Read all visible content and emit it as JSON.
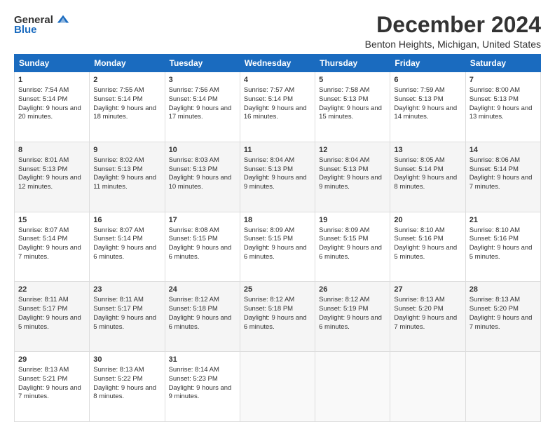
{
  "logo": {
    "general": "General",
    "blue": "Blue"
  },
  "title": "December 2024",
  "subtitle": "Benton Heights, Michigan, United States",
  "headers": [
    "Sunday",
    "Monday",
    "Tuesday",
    "Wednesday",
    "Thursday",
    "Friday",
    "Saturday"
  ],
  "weeks": [
    [
      {
        "day": "1",
        "sunrise": "Sunrise: 7:54 AM",
        "sunset": "Sunset: 5:14 PM",
        "daylight": "Daylight: 9 hours and 20 minutes."
      },
      {
        "day": "2",
        "sunrise": "Sunrise: 7:55 AM",
        "sunset": "Sunset: 5:14 PM",
        "daylight": "Daylight: 9 hours and 18 minutes."
      },
      {
        "day": "3",
        "sunrise": "Sunrise: 7:56 AM",
        "sunset": "Sunset: 5:14 PM",
        "daylight": "Daylight: 9 hours and 17 minutes."
      },
      {
        "day": "4",
        "sunrise": "Sunrise: 7:57 AM",
        "sunset": "Sunset: 5:14 PM",
        "daylight": "Daylight: 9 hours and 16 minutes."
      },
      {
        "day": "5",
        "sunrise": "Sunrise: 7:58 AM",
        "sunset": "Sunset: 5:13 PM",
        "daylight": "Daylight: 9 hours and 15 minutes."
      },
      {
        "day": "6",
        "sunrise": "Sunrise: 7:59 AM",
        "sunset": "Sunset: 5:13 PM",
        "daylight": "Daylight: 9 hours and 14 minutes."
      },
      {
        "day": "7",
        "sunrise": "Sunrise: 8:00 AM",
        "sunset": "Sunset: 5:13 PM",
        "daylight": "Daylight: 9 hours and 13 minutes."
      }
    ],
    [
      {
        "day": "8",
        "sunrise": "Sunrise: 8:01 AM",
        "sunset": "Sunset: 5:13 PM",
        "daylight": "Daylight: 9 hours and 12 minutes."
      },
      {
        "day": "9",
        "sunrise": "Sunrise: 8:02 AM",
        "sunset": "Sunset: 5:13 PM",
        "daylight": "Daylight: 9 hours and 11 minutes."
      },
      {
        "day": "10",
        "sunrise": "Sunrise: 8:03 AM",
        "sunset": "Sunset: 5:13 PM",
        "daylight": "Daylight: 9 hours and 10 minutes."
      },
      {
        "day": "11",
        "sunrise": "Sunrise: 8:04 AM",
        "sunset": "Sunset: 5:13 PM",
        "daylight": "Daylight: 9 hours and 9 minutes."
      },
      {
        "day": "12",
        "sunrise": "Sunrise: 8:04 AM",
        "sunset": "Sunset: 5:13 PM",
        "daylight": "Daylight: 9 hours and 9 minutes."
      },
      {
        "day": "13",
        "sunrise": "Sunrise: 8:05 AM",
        "sunset": "Sunset: 5:14 PM",
        "daylight": "Daylight: 9 hours and 8 minutes."
      },
      {
        "day": "14",
        "sunrise": "Sunrise: 8:06 AM",
        "sunset": "Sunset: 5:14 PM",
        "daylight": "Daylight: 9 hours and 7 minutes."
      }
    ],
    [
      {
        "day": "15",
        "sunrise": "Sunrise: 8:07 AM",
        "sunset": "Sunset: 5:14 PM",
        "daylight": "Daylight: 9 hours and 7 minutes."
      },
      {
        "day": "16",
        "sunrise": "Sunrise: 8:07 AM",
        "sunset": "Sunset: 5:14 PM",
        "daylight": "Daylight: 9 hours and 6 minutes."
      },
      {
        "day": "17",
        "sunrise": "Sunrise: 8:08 AM",
        "sunset": "Sunset: 5:15 PM",
        "daylight": "Daylight: 9 hours and 6 minutes."
      },
      {
        "day": "18",
        "sunrise": "Sunrise: 8:09 AM",
        "sunset": "Sunset: 5:15 PM",
        "daylight": "Daylight: 9 hours and 6 minutes."
      },
      {
        "day": "19",
        "sunrise": "Sunrise: 8:09 AM",
        "sunset": "Sunset: 5:15 PM",
        "daylight": "Daylight: 9 hours and 6 minutes."
      },
      {
        "day": "20",
        "sunrise": "Sunrise: 8:10 AM",
        "sunset": "Sunset: 5:16 PM",
        "daylight": "Daylight: 9 hours and 5 minutes."
      },
      {
        "day": "21",
        "sunrise": "Sunrise: 8:10 AM",
        "sunset": "Sunset: 5:16 PM",
        "daylight": "Daylight: 9 hours and 5 minutes."
      }
    ],
    [
      {
        "day": "22",
        "sunrise": "Sunrise: 8:11 AM",
        "sunset": "Sunset: 5:17 PM",
        "daylight": "Daylight: 9 hours and 5 minutes."
      },
      {
        "day": "23",
        "sunrise": "Sunrise: 8:11 AM",
        "sunset": "Sunset: 5:17 PM",
        "daylight": "Daylight: 9 hours and 5 minutes."
      },
      {
        "day": "24",
        "sunrise": "Sunrise: 8:12 AM",
        "sunset": "Sunset: 5:18 PM",
        "daylight": "Daylight: 9 hours and 6 minutes."
      },
      {
        "day": "25",
        "sunrise": "Sunrise: 8:12 AM",
        "sunset": "Sunset: 5:18 PM",
        "daylight": "Daylight: 9 hours and 6 minutes."
      },
      {
        "day": "26",
        "sunrise": "Sunrise: 8:12 AM",
        "sunset": "Sunset: 5:19 PM",
        "daylight": "Daylight: 9 hours and 6 minutes."
      },
      {
        "day": "27",
        "sunrise": "Sunrise: 8:13 AM",
        "sunset": "Sunset: 5:20 PM",
        "daylight": "Daylight: 9 hours and 7 minutes."
      },
      {
        "day": "28",
        "sunrise": "Sunrise: 8:13 AM",
        "sunset": "Sunset: 5:20 PM",
        "daylight": "Daylight: 9 hours and 7 minutes."
      }
    ],
    [
      {
        "day": "29",
        "sunrise": "Sunrise: 8:13 AM",
        "sunset": "Sunset: 5:21 PM",
        "daylight": "Daylight: 9 hours and 7 minutes."
      },
      {
        "day": "30",
        "sunrise": "Sunrise: 8:13 AM",
        "sunset": "Sunset: 5:22 PM",
        "daylight": "Daylight: 9 hours and 8 minutes."
      },
      {
        "day": "31",
        "sunrise": "Sunrise: 8:14 AM",
        "sunset": "Sunset: 5:23 PM",
        "daylight": "Daylight: 9 hours and 9 minutes."
      },
      null,
      null,
      null,
      null
    ]
  ]
}
